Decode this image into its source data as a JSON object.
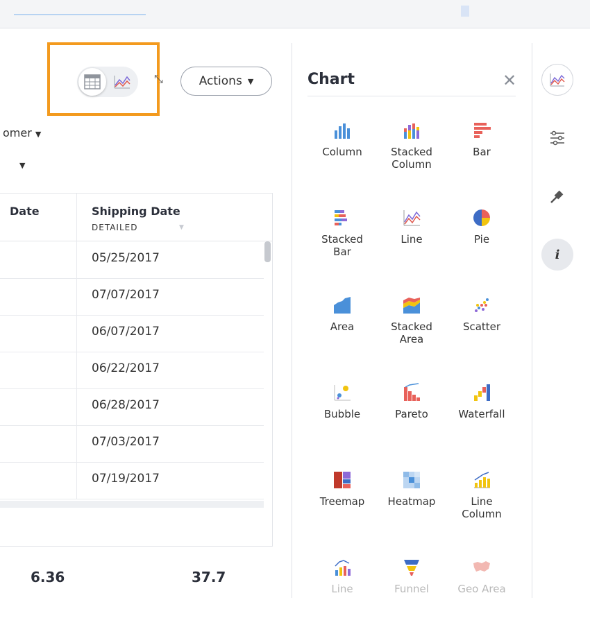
{
  "header": {
    "actions_label": "Actions"
  },
  "filters": {
    "partial_label": "omer"
  },
  "table": {
    "col1_header": "Date",
    "col2_header": "Shipping Date",
    "col2_sub": "DETAILED",
    "rows": [
      "05/25/2017",
      "07/07/2017",
      "06/07/2017",
      "06/22/2017",
      "06/28/2017",
      "07/03/2017",
      "07/19/2017"
    ],
    "totals": [
      "6.36",
      "37.7"
    ]
  },
  "panel": {
    "title": "Chart",
    "types": [
      [
        "Column"
      ],
      [
        "Stacked",
        "Column"
      ],
      [
        "Bar"
      ],
      [
        "Stacked",
        "Bar"
      ],
      [
        "Line"
      ],
      [
        "Pie"
      ],
      [
        "Area"
      ],
      [
        "Stacked",
        "Area"
      ],
      [
        "Scatter"
      ],
      [
        "Bubble"
      ],
      [
        "Pareto"
      ],
      [
        "Waterfall"
      ],
      [
        "Treemap"
      ],
      [
        "Heatmap"
      ],
      [
        "Line",
        "Column"
      ],
      [
        "Line"
      ],
      [
        "Funnel"
      ],
      [
        "Geo Area"
      ]
    ]
  },
  "icons": [
    "table-icon",
    "line-chart-icon",
    "expand-icon",
    "close-icon",
    "settings-sliders-icon",
    "pin-icon",
    "info-icon"
  ],
  "colors": {
    "highlight": "#f39a1e",
    "accent_blue": "#4a90d9"
  }
}
